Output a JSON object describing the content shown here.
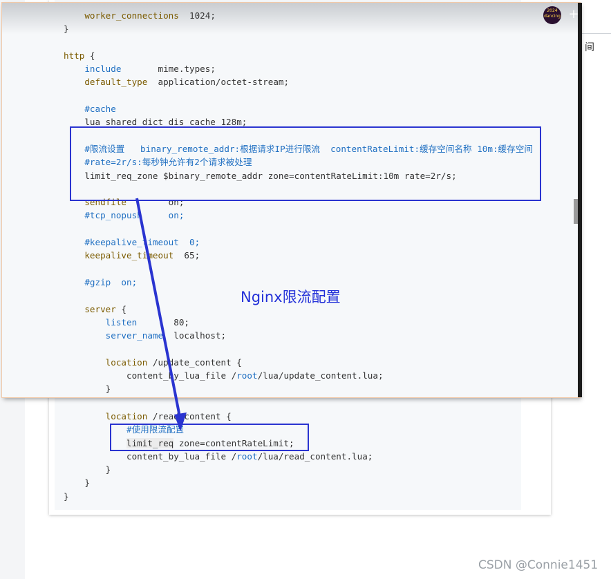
{
  "video_overlay": {
    "title": "Nginx限流配置",
    "avatar_text": "2024\ndancing",
    "add_button": "+"
  },
  "code_top": [
    [
      {
        "t": "    "
      },
      {
        "t": "worker_connections",
        "c": "k"
      },
      {
        "t": "  1024;"
      }
    ],
    [
      {
        "t": "}"
      }
    ],
    [
      {
        "t": ""
      }
    ],
    [
      {
        "t": "http",
        "c": "k"
      },
      {
        "t": " {"
      }
    ],
    [
      {
        "t": "    "
      },
      {
        "t": "include",
        "c": "d"
      },
      {
        "t": "       mime.types;"
      }
    ],
    [
      {
        "t": "    "
      },
      {
        "t": "default_type",
        "c": "k"
      },
      {
        "t": "  application/octet-stream;"
      }
    ],
    [
      {
        "t": ""
      }
    ],
    [
      {
        "t": "    "
      },
      {
        "t": "#cache",
        "c": "c"
      }
    ],
    [
      {
        "t": "    lua_shared_dict dis_cache 128m;"
      }
    ],
    [
      {
        "t": ""
      }
    ],
    [
      {
        "t": "    "
      },
      {
        "t": "#限流设置   binary_remote_addr:根据请求IP进行限流  contentRateLimit:缓存空间名称 10m:缓存空间",
        "c": "c"
      }
    ],
    [
      {
        "t": "    "
      },
      {
        "t": "#rate=2r/s:每秒钟允许有2个请求被处理",
        "c": "c"
      }
    ],
    [
      {
        "t": "    limit_req_zone $binary_remote_addr zone=contentRateLimit:10m rate=2r/s;"
      }
    ],
    [
      {
        "t": ""
      }
    ],
    [
      {
        "t": "    "
      },
      {
        "t": "sendfile",
        "c": "k"
      },
      {
        "t": "        on;"
      }
    ],
    [
      {
        "t": "    "
      },
      {
        "t": "#tcp_nopush",
        "c": "c"
      },
      {
        "t": "     "
      },
      {
        "t": "on;",
        "c": "c"
      }
    ],
    [
      {
        "t": ""
      }
    ],
    [
      {
        "t": "    "
      },
      {
        "t": "#keepalive_timeout  0;",
        "c": "c"
      }
    ],
    [
      {
        "t": "    "
      },
      {
        "t": "keepalive_timeout",
        "c": "k"
      },
      {
        "t": "  65;"
      }
    ],
    [
      {
        "t": ""
      }
    ],
    [
      {
        "t": "    "
      },
      {
        "t": "#gzip  on;",
        "c": "c"
      }
    ],
    [
      {
        "t": ""
      }
    ],
    [
      {
        "t": "    "
      },
      {
        "t": "server",
        "c": "k"
      },
      {
        "t": " {"
      }
    ],
    [
      {
        "t": "        "
      },
      {
        "t": "listen",
        "c": "d"
      },
      {
        "t": "       80;"
      }
    ],
    [
      {
        "t": "        "
      },
      {
        "t": "server_name",
        "c": "d"
      },
      {
        "t": "  localhost;"
      }
    ],
    [
      {
        "t": ""
      }
    ],
    [
      {
        "t": "        "
      },
      {
        "t": "location",
        "c": "k"
      },
      {
        "t": " /update_content {"
      }
    ],
    [
      {
        "t": "            content_by_lua_file /"
      },
      {
        "t": "root",
        "c": "d"
      },
      {
        "t": "/lua/update_content.lua;"
      }
    ],
    [
      {
        "t": "        }"
      }
    ]
  ],
  "code_bottom": [
    [
      {
        "t": "        "
      },
      {
        "t": "location",
        "c": "k"
      },
      {
        "t": " /read_content {"
      }
    ],
    [
      {
        "t": "            "
      },
      {
        "t": "#使用限流配置",
        "c": "c"
      }
    ],
    [
      {
        "t": "            "
      },
      {
        "t": "limit_req",
        "c": "hl"
      },
      {
        "t": " zone=contentRateLimit;"
      }
    ],
    [
      {
        "t": "            content_by_lua_file /"
      },
      {
        "t": "root",
        "c": "d"
      },
      {
        "t": "/lua/read_content.lua;"
      }
    ],
    [
      {
        "t": "        }"
      }
    ],
    [
      {
        "t": "    }"
      }
    ],
    [
      {
        "t": "}"
      }
    ]
  ],
  "right_edge_char": "间",
  "watermark": "CSDN @Connie1451",
  "colors": {
    "annotation_blue": "#2a34d0",
    "keyword": "#7b5b00",
    "directive": "#1f6fc2"
  }
}
